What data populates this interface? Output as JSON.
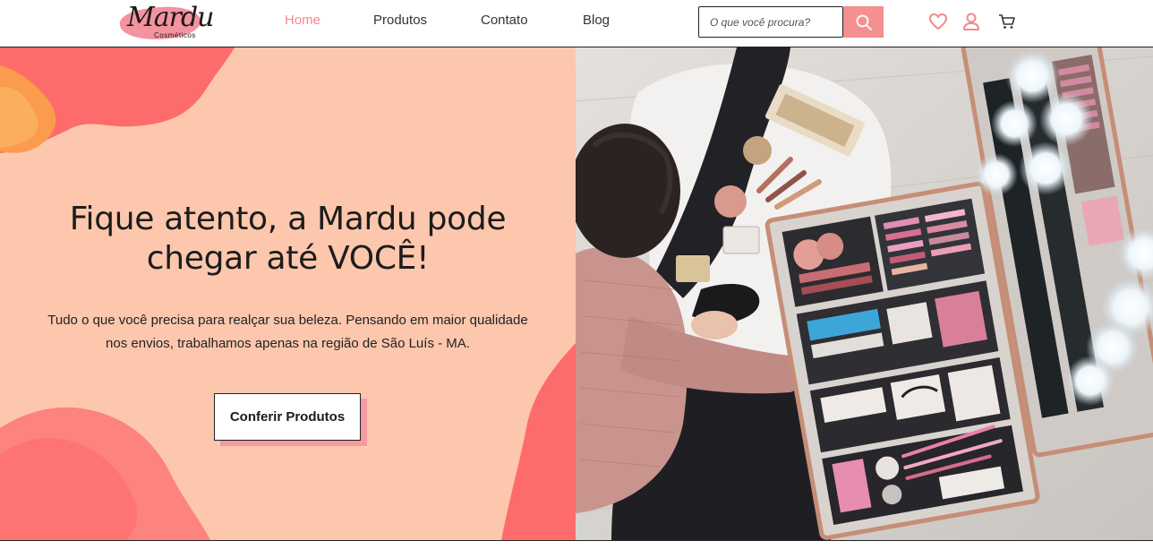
{
  "brand": {
    "name": "Mardu",
    "tagline": "Cosméticos",
    "accent": "#f4908f",
    "hero_bg": "#fcc7ad"
  },
  "nav": {
    "items": [
      {
        "label": "Home",
        "active": true
      },
      {
        "label": "Produtos",
        "active": false
      },
      {
        "label": "Contato",
        "active": false
      },
      {
        "label": "Blog",
        "active": false
      }
    ]
  },
  "search": {
    "placeholder": "O que você procura?",
    "icon": "search-icon"
  },
  "header_icons": [
    "heart-icon",
    "user-icon",
    "cart-icon"
  ],
  "hero": {
    "title_line1": "Fique atento, a Mardu pode",
    "title_line2": "chegar até VOCÊ!",
    "desc_line1": "Tudo o que você precisa para realçar sua beleza. Pensando em maior qualidade",
    "desc_line2": "nos envios, trabalhamos apenas na região de São Luís - MA.",
    "cta_label": "Conferir Produtos"
  }
}
